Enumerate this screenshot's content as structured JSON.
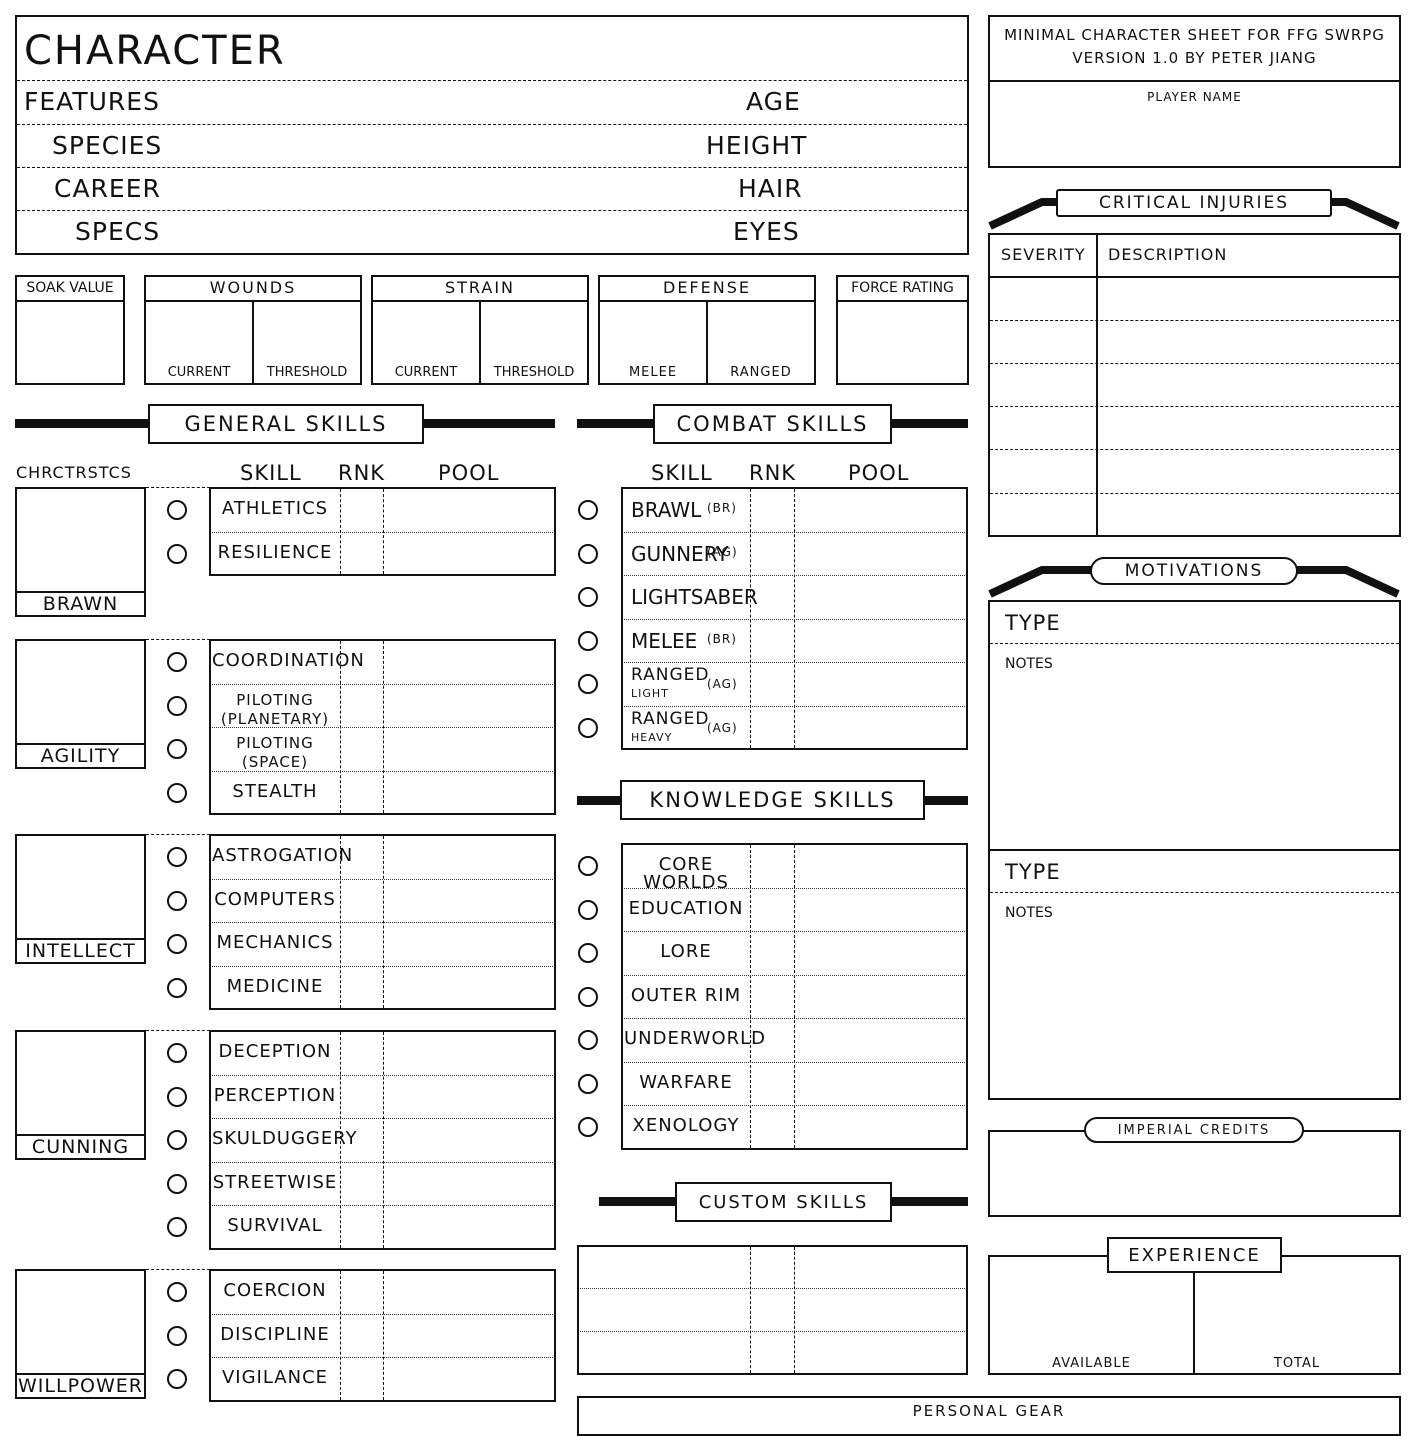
{
  "header": {
    "title": "CHARACTER",
    "left_fields": [
      "FEATURES",
      "SPECIES",
      "CAREER",
      "SPECS"
    ],
    "right_fields": [
      "AGE",
      "HEIGHT",
      "HAIR",
      "EYES"
    ]
  },
  "info": {
    "line1": "MINIMAL CHARACTER SHEET FOR FFG SWRPG",
    "line2": "VERSION 1.0 BY PETER JIANG",
    "player_name": "PLAYER NAME"
  },
  "stats": {
    "soak": "SOAK VALUE",
    "wounds": "WOUNDS",
    "strain": "STRAIN",
    "defense": "DEFENSE",
    "force": "FORCE RATING",
    "current": "CURRENT",
    "threshold": "THRESHOLD",
    "melee": "MELEE",
    "ranged": "RANGED"
  },
  "general": {
    "title": "GENERAL SKILLS",
    "chrctrstcs": "CHRCTRSTCS",
    "skill": "SKILL",
    "rnk": "RNK",
    "pool": "POOL",
    "groups": [
      {
        "char": "BRAWN",
        "skills": [
          "ATHLETICS",
          "RESILIENCE"
        ]
      },
      {
        "char": "AGILITY",
        "skills": [
          "COORDINATION",
          "PILOTING\n(PLANETARY)",
          "PILOTING\n(SPACE)",
          "STEALTH"
        ]
      },
      {
        "char": "INTELLECT",
        "skills": [
          "ASTROGATION",
          "COMPUTERS",
          "MECHANICS",
          "MEDICINE"
        ]
      },
      {
        "char": "CUNNING",
        "skills": [
          "DECEPTION",
          "PERCEPTION",
          "SKULDUGGERY",
          "STREETWISE",
          "SURVIVAL"
        ]
      },
      {
        "char": "WILLPOWER",
        "skills": [
          "COERCION",
          "DISCIPLINE",
          "VIGILANCE"
        ]
      }
    ]
  },
  "combat": {
    "title": "COMBAT SKILLS",
    "skill": "SKILL",
    "rnk": "RNK",
    "pool": "POOL",
    "skills": [
      {
        "name": "BRAWL",
        "sub": "",
        "tag": "(BR)"
      },
      {
        "name": "GUNNERY",
        "sub": "",
        "tag": "(AG)"
      },
      {
        "name": "LIGHTSABER",
        "sub": "",
        "tag": ""
      },
      {
        "name": "MELEE",
        "sub": "",
        "tag": "(BR)"
      },
      {
        "name": "RANGED",
        "sub": "LIGHT",
        "tag": "(AG)"
      },
      {
        "name": "RANGED",
        "sub": "HEAVY",
        "tag": "(AG)"
      }
    ]
  },
  "knowledge": {
    "title": "KNOWLEDGE SKILLS",
    "skills": [
      "CORE WORLDS",
      "EDUCATION",
      "LORE",
      "OUTER RIM",
      "UNDERWORLD",
      "WARFARE",
      "XENOLOGY"
    ]
  },
  "custom": {
    "title": "CUSTOM SKILLS"
  },
  "critical": {
    "title": "CRITICAL INJURIES",
    "severity": "SEVERITY",
    "description": "DESCRIPTION"
  },
  "motivations": {
    "title": "MOTIVATIONS",
    "type": "TYPE",
    "notes": "NOTES"
  },
  "credits": {
    "title": "IMPERIAL CREDITS"
  },
  "experience": {
    "title": "EXPERIENCE",
    "available": "AVAILABLE",
    "total": "TOTAL"
  },
  "gear": {
    "title": "PERSONAL GEAR"
  }
}
